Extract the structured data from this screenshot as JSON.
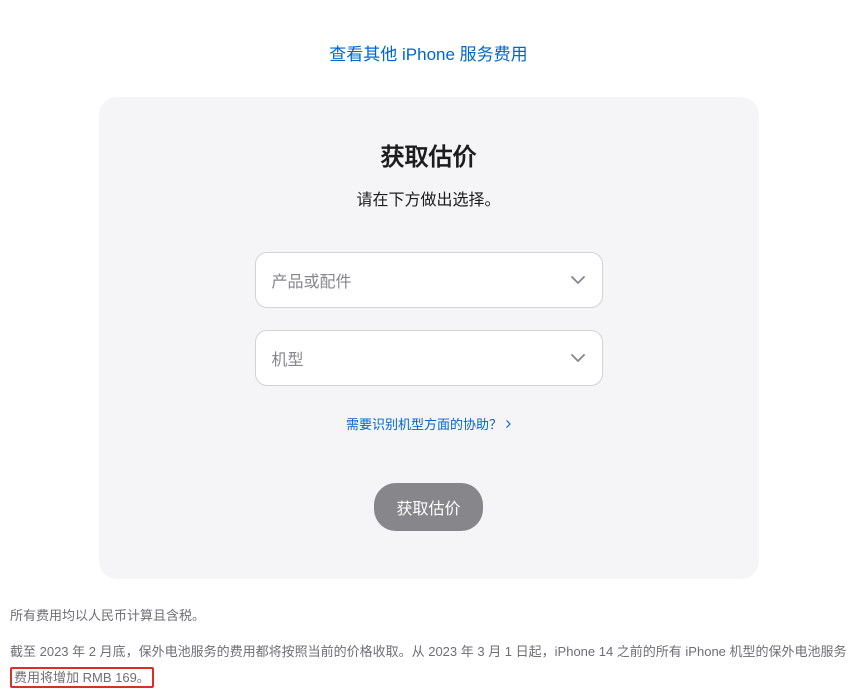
{
  "topLink": "查看其他 iPhone 服务费用",
  "card": {
    "title": "获取估价",
    "subtitle": "请在下方做出选择。",
    "select1Placeholder": "产品或配件",
    "select2Placeholder": "机型",
    "helpLink": "需要识别机型方面的协助？",
    "submitLabel": "获取估价"
  },
  "footer": {
    "line1": "所有费用均以人民币计算且含税。",
    "line2_part1": "截至 2023 年 2 月底，保外电池服务的费用都将按照当前的价格收取。从 2023 年 3 月 1 日起，iPhone 14 之前的所有 iPhone 机型的保外电池服务",
    "line2_highlight": "费用将增加 RMB 169。"
  }
}
